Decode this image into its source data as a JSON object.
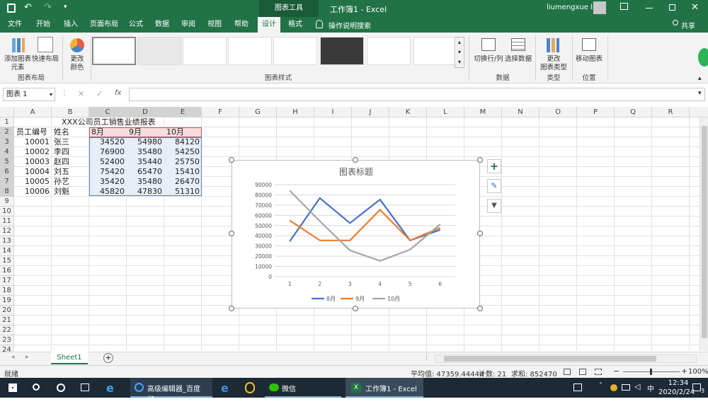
{
  "titlebar": {
    "tool_context": "图表工具",
    "doc_title": "工作簿1",
    "sep": "-",
    "app": "Excel",
    "user": "liumengxue liu"
  },
  "tabs": [
    "文件",
    "开始",
    "插入",
    "页面布局",
    "公式",
    "数据",
    "审阅",
    "视图",
    "帮助",
    "设计",
    "格式"
  ],
  "tell_me": "操作说明搜索",
  "share": "共享",
  "ribbon": {
    "add_element": "添加图表\n元素",
    "quick_layout": "快速布局",
    "change_colors": "更改\n颜色",
    "group_layout": "图表布局",
    "group_styles": "图表样式",
    "switch_rowcol": "切换行/列",
    "select_data": "选择数据",
    "group_data": "数据",
    "change_type": "更改\n图表类型",
    "group_type": "类型",
    "move_chart": "移动图表",
    "group_location": "位置"
  },
  "formula_bar": {
    "name_box": "图表 1",
    "fx": "fx",
    "value": ""
  },
  "columns": [
    "A",
    "B",
    "C",
    "D",
    "E",
    "F",
    "G",
    "H",
    "I",
    "J",
    "K",
    "L",
    "M",
    "N",
    "O",
    "P",
    "Q",
    "R"
  ],
  "rows": [
    "1",
    "2",
    "3",
    "4",
    "5",
    "6",
    "7",
    "8",
    "9",
    "10",
    "11",
    "12",
    "13",
    "14",
    "15",
    "16",
    "17",
    "18",
    "19",
    "20",
    "21",
    "22",
    "23",
    "24"
  ],
  "sheet": {
    "title": "XXX公司员工销售业绩报表",
    "headers": [
      "员工编号",
      "姓名",
      "8月",
      "9月",
      "10月"
    ],
    "data": [
      [
        "10001",
        "张三",
        "34520",
        "54980",
        "84120"
      ],
      [
        "10002",
        "李四",
        "76900",
        "35480",
        "54250"
      ],
      [
        "10003",
        "赵四",
        "52400",
        "35440",
        "25750"
      ],
      [
        "10004",
        "刘五",
        "75420",
        "65470",
        "15410"
      ],
      [
        "10005",
        "孙艺",
        "35420",
        "35480",
        "26470"
      ],
      [
        "10006",
        "刘魁",
        "45820",
        "47830",
        "51310"
      ]
    ]
  },
  "chart_data": {
    "type": "line",
    "title": "图表标题",
    "categories": [
      "1",
      "2",
      "3",
      "4",
      "5",
      "6"
    ],
    "series": [
      {
        "name": "8月",
        "values": [
          34520,
          76900,
          52400,
          75420,
          35420,
          45820
        ],
        "color": "#4472c4"
      },
      {
        "name": "9月",
        "values": [
          54980,
          35480,
          35440,
          65470,
          35480,
          47830
        ],
        "color": "#ed7d31"
      },
      {
        "name": "10月",
        "values": [
          84120,
          54250,
          25750,
          15410,
          26470,
          51310
        ],
        "color": "#a5a5a5"
      }
    ],
    "ylim": [
      0,
      90000
    ],
    "yticks": [
      "0",
      "10000",
      "20000",
      "30000",
      "40000",
      "50000",
      "60000",
      "70000",
      "80000",
      "90000"
    ],
    "grid": true,
    "legend": "bottom"
  },
  "sheet_tab": "Sheet1",
  "status": {
    "ready": "就绪",
    "average": "平均值: 47359.44444",
    "count": "计数: 21",
    "sum": "求和: 852470",
    "zoom": "100%"
  },
  "taskbar": {
    "app1": "高级编辑器_百度经...",
    "app2": "微信",
    "app3": "工作簿1 - Excel",
    "time": "12:34",
    "date": "2020/2/24",
    "notif": "3"
  }
}
